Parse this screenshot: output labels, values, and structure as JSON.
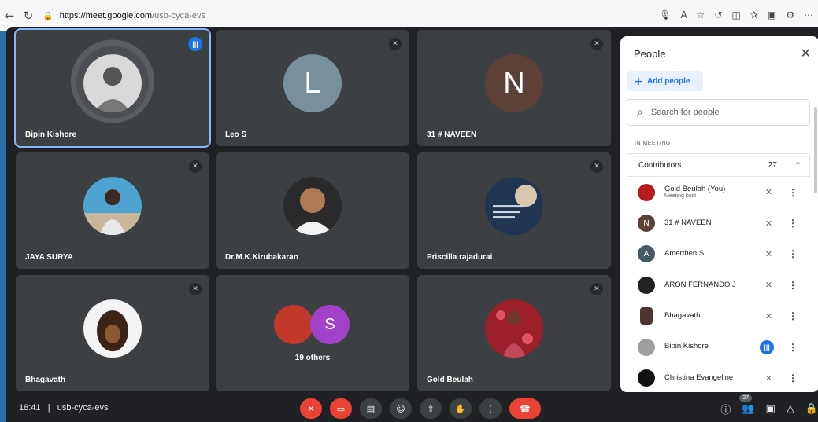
{
  "browser": {
    "url_host": "https://meet.google.com",
    "url_path": "/usb-cyca-evs"
  },
  "tiles": [
    {
      "name": "Bipin Kishore",
      "avatar_type": "photo",
      "speaking": true
    },
    {
      "name": "Leo S",
      "avatar_type": "letter",
      "letter": "L",
      "color": "#78909c"
    },
    {
      "name": "31 # NAVEEN",
      "avatar_type": "letter",
      "letter": "N",
      "color": "#5d4037"
    },
    {
      "name": "JAYA SURYA",
      "avatar_type": "photo"
    },
    {
      "name": "Dr.M.K.Kirubakaran",
      "avatar_type": "photo"
    },
    {
      "name": "Priscilla rajadurai",
      "avatar_type": "photo"
    },
    {
      "name": "Bhagavath",
      "avatar_type": "photo"
    },
    {
      "name": "19 others",
      "avatar_type": "group",
      "letter": "S"
    },
    {
      "name": "Gold Beulah",
      "avatar_type": "photo"
    }
  ],
  "panel": {
    "title": "People",
    "add_people": "Add people",
    "search_placeholder": "Search for people",
    "section_label": "IN MEETING",
    "contributors_label": "Contributors",
    "contributors_count": "27",
    "participants": [
      {
        "name": "Gold Beulah (You)",
        "role": "Meeting host",
        "avatar": "photo",
        "color": "#b71c1c",
        "speaking": false
      },
      {
        "name": "31 # NAVEEN",
        "avatar": "letter",
        "letter": "N",
        "color": "#5d4037",
        "speaking": false
      },
      {
        "name": "Amerthen S",
        "avatar": "letter",
        "letter": "A",
        "color": "#455a64",
        "speaking": false
      },
      {
        "name": "ARON FERNANDO J",
        "avatar": "photo",
        "color": "#222222",
        "speaking": false
      },
      {
        "name": "Bhagavath",
        "avatar": "photo",
        "color": "#4e342e",
        "speaking": false
      },
      {
        "name": "Bipin Kishore",
        "avatar": "photo",
        "color": "#9e9e9e",
        "speaking": true
      },
      {
        "name": "Christina Evangeline",
        "avatar": "photo",
        "color": "#111111",
        "speaking": false
      }
    ]
  },
  "bottom": {
    "time": "18:41",
    "meeting_code": "usb-cyca-evs",
    "people_badge": "27"
  },
  "colors": {
    "accent": "#1a73e8",
    "danger": "#ea4335",
    "tile_bg": "#3c4043",
    "meet_bg": "#202124"
  }
}
